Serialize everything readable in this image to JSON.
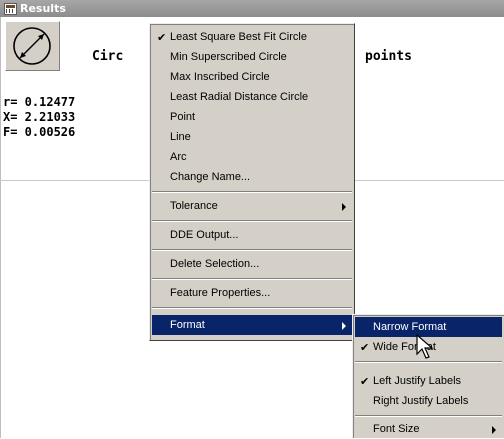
{
  "window": {
    "title": "Results"
  },
  "feature": {
    "name_visible": "Circ",
    "points_visible": "points",
    "values": [
      "r= 0.12477",
      "X= 2.21033",
      "F= 0.00526"
    ]
  },
  "context_menu": {
    "items": [
      {
        "label": "Least Square Best Fit Circle",
        "checked": true,
        "check_mark": "✔"
      },
      {
        "label": "Min Superscribed Circle"
      },
      {
        "label": "Max Inscribed Circle"
      },
      {
        "label": "Least Radial Distance Circle"
      },
      {
        "label": "Point"
      },
      {
        "label": "Line"
      },
      {
        "label": "Arc"
      },
      {
        "label": "Change Name..."
      },
      {
        "label": "Tolerance",
        "submenu": true
      },
      {
        "label": "DDE Output..."
      },
      {
        "label": "Delete Selection..."
      },
      {
        "label": "Feature Properties..."
      },
      {
        "label": "Format",
        "submenu": true,
        "highlighted": true
      }
    ]
  },
  "format_submenu": {
    "items": [
      {
        "label": "Narrow Format",
        "highlighted": true
      },
      {
        "label": "Wide Format",
        "checked": true,
        "check_mark": "✔"
      },
      {
        "label": "Left Justify Labels",
        "checked": true,
        "check_mark": "✔"
      },
      {
        "label": "Right Justify Labels"
      },
      {
        "label": "Font Size",
        "submenu": true
      }
    ]
  },
  "colors": {
    "menu_bg": "#d4d0c8",
    "highlight": "#0a246a",
    "titlebar": "#999999"
  }
}
